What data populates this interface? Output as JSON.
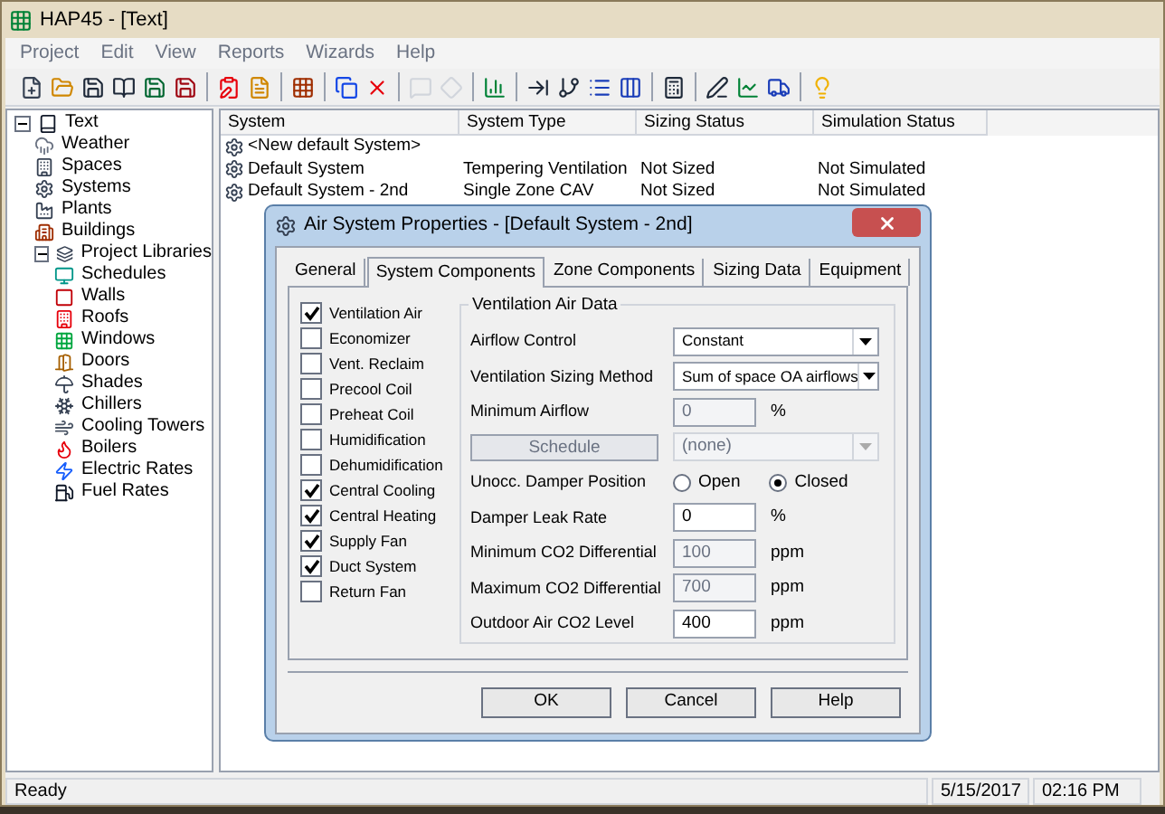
{
  "window": {
    "title": "HAP45 - [Text]"
  },
  "menu": [
    {
      "label": "Project",
      "disabled": true
    },
    {
      "label": "Edit",
      "disabled": true
    },
    {
      "label": "View",
      "disabled": true
    },
    {
      "label": "Reports",
      "disabled": true
    },
    {
      "label": "Wizards",
      "disabled": true
    },
    {
      "label": "Help",
      "disabled": true
    }
  ],
  "tree": [
    {
      "label": "Text",
      "expanded": true,
      "children": [
        {
          "label": "Weather"
        },
        {
          "label": "Spaces"
        },
        {
          "label": "Systems"
        },
        {
          "label": "Plants"
        },
        {
          "label": "Buildings"
        },
        {
          "label": "Project Libraries",
          "expanded": true,
          "children": [
            {
              "label": "Schedules"
            },
            {
              "label": "Walls"
            },
            {
              "label": "Roofs"
            },
            {
              "label": "Windows"
            },
            {
              "label": "Doors"
            },
            {
              "label": "Shades"
            },
            {
              "label": "Chillers"
            },
            {
              "label": "Cooling Towers"
            },
            {
              "label": "Boilers"
            },
            {
              "label": "Electric Rates"
            },
            {
              "label": "Fuel Rates"
            }
          ]
        }
      ]
    }
  ],
  "table": {
    "columns": [
      "System",
      "System Type",
      "Sizing Status",
      "Simulation Status"
    ],
    "rows": [
      [
        "<New default System>",
        "",
        "",
        ""
      ],
      [
        "Default System",
        "Tempering Ventilation",
        "Not Sized",
        "Not Simulated"
      ],
      [
        "Default System - 2nd",
        "Single Zone CAV",
        "Not Sized",
        "Not Simulated"
      ]
    ]
  },
  "dialog": {
    "title": "Air System Properties - [Default System - 2nd]",
    "tabs": [
      {
        "label": "General",
        "selected": false
      },
      {
        "label": "System Components",
        "selected": true
      },
      {
        "label": "Zone Components",
        "selected": false
      },
      {
        "label": "Sizing Data",
        "selected": false
      },
      {
        "label": "Equipment",
        "selected": false
      }
    ],
    "components": [
      {
        "label": "Ventilation Air",
        "checked": true
      },
      {
        "label": "Economizer",
        "checked": false
      },
      {
        "label": "Vent. Reclaim",
        "checked": false
      },
      {
        "label": "Precool Coil",
        "checked": false
      },
      {
        "label": "Preheat Coil",
        "checked": false
      },
      {
        "label": "Humidification",
        "checked": false
      },
      {
        "label": "Dehumidification",
        "checked": false
      },
      {
        "label": "Central Cooling",
        "checked": true
      },
      {
        "label": "Central Heating",
        "checked": true
      },
      {
        "label": "Supply Fan",
        "checked": true
      },
      {
        "label": "Duct System",
        "checked": true
      },
      {
        "label": "Return Fan",
        "checked": false
      }
    ],
    "group_title": "Ventilation Air Data",
    "rows": [
      {
        "kind": "dropdown",
        "label": "Airflow Control",
        "value": "Constant",
        "disabled": false
      },
      {
        "kind": "dropdown",
        "label": "Ventilation Sizing Method",
        "value": "Sum of space OA airflows",
        "disabled": false
      },
      {
        "kind": "input",
        "label": "Minimum Airflow",
        "value": "0",
        "unit": "%",
        "disabled": true
      },
      {
        "kind": "button_dropdown",
        "button": "Schedule",
        "value": "(none)",
        "disabled": true
      },
      {
        "kind": "radio",
        "label": "Unocc. Damper Position",
        "options": [
          {
            "label": "Open",
            "selected": false
          },
          {
            "label": "Closed",
            "selected": true
          }
        ]
      },
      {
        "kind": "input",
        "label": "Damper Leak Rate",
        "value": "0",
        "unit": "%",
        "disabled": false
      },
      {
        "kind": "input",
        "label": "Minimum CO2 Differential",
        "value": "100",
        "unit": "ppm",
        "disabled": true
      },
      {
        "kind": "input",
        "label": "Maximum CO2 Differential",
        "value": "700",
        "unit": "ppm",
        "disabled": true
      },
      {
        "kind": "input",
        "label": "Outdoor Air CO2 Level",
        "value": "400",
        "unit": "ppm",
        "disabled": false
      }
    ],
    "buttons": [
      "OK",
      "Cancel",
      "Help"
    ]
  },
  "status_bar": {
    "message": "Ready",
    "date": "5/15/2017",
    "time": "02:16 PM"
  }
}
